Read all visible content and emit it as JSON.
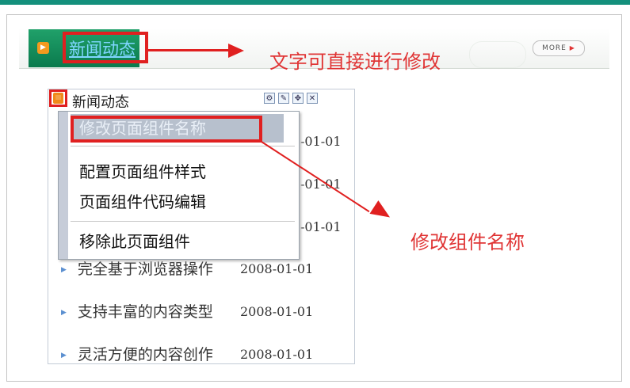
{
  "header": {
    "title": "新闻动态",
    "more_label": "MORE"
  },
  "annotations": {
    "title_edit": "文字可直接进行修改",
    "rename_component": "修改组件名称"
  },
  "widget": {
    "title": "新闻动态",
    "tools": [
      "settings-icon",
      "edit-icon",
      "move-icon",
      "close-icon"
    ],
    "hidden_dates": [
      "-01-01",
      "-01-01",
      "-01-01"
    ],
    "items": [
      {
        "text": "完全基于浏览器操作",
        "date": "2008-01-01"
      },
      {
        "text": "支持丰富的内容类型",
        "date": "2008-01-01"
      },
      {
        "text": "灵活方便的内容创作",
        "date": "2008-01-01"
      }
    ]
  },
  "context_menu": {
    "items": [
      {
        "label": "修改页面组件名称",
        "selected": true
      },
      {
        "label": "配置页面组件样式",
        "selected": false
      },
      {
        "label": "页面组件代码编辑",
        "selected": false
      },
      {
        "label": "移除此页面组件",
        "selected": false
      }
    ]
  },
  "colors": {
    "accent_green": "#14907c",
    "annotation_red": "#e02020",
    "bullet_blue": "#5b8fd0"
  }
}
